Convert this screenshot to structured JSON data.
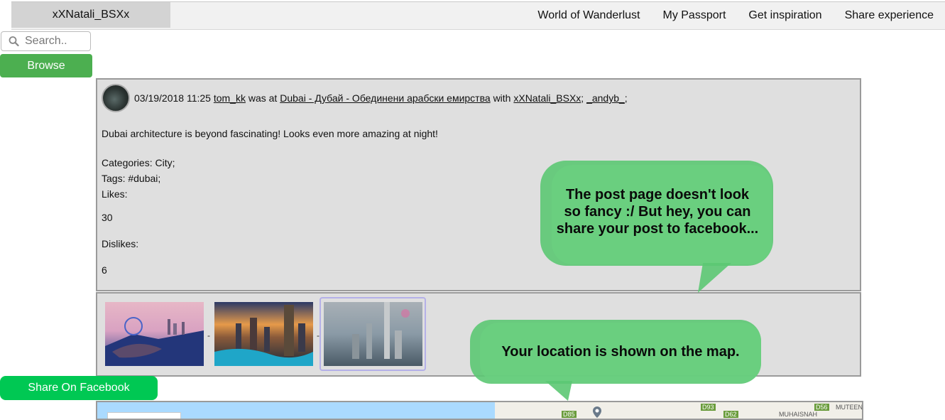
{
  "header": {
    "username": "xXNatali_BSXx",
    "nav": [
      "World of Wanderlust",
      "My Passport",
      "Get inspiration",
      "Share experience"
    ]
  },
  "search": {
    "placeholder": "Search..",
    "icon": "search-icon"
  },
  "browse_label": "Browse",
  "post": {
    "date": "03/19/2018 11:25",
    "author": "tom_kk",
    "was_at": "was at",
    "location": "Dubai - Дубай - Обединени арабски емирства",
    "with": "with",
    "tagged": [
      "xXNatali_BSXx",
      "_andyb_"
    ],
    "text": "Dubai architecture is beyond fascinating! Looks even more amazing at night!",
    "categories": "Categories: City;",
    "tags": "Tags: #dubai;",
    "likes_label": "Likes:",
    "likes": "30",
    "dislikes_label": "Dislikes:",
    "dislikes": "6"
  },
  "gallery": {
    "separator": "-",
    "count": 3
  },
  "share_label": "Share On Facebook",
  "callouts": {
    "top": [
      "The post page doesn't look",
      "so fancy :/ But hey, you can",
      "share your post to facebook..."
    ],
    "bottom": "Your location is shown on the map.",
    "color": "#5cc873"
  },
  "map": {
    "road_labels": [
      "D85",
      "D93",
      "D62",
      "D56"
    ],
    "place_labels": [
      "MUHAISNAH",
      "MUTEENA"
    ]
  }
}
